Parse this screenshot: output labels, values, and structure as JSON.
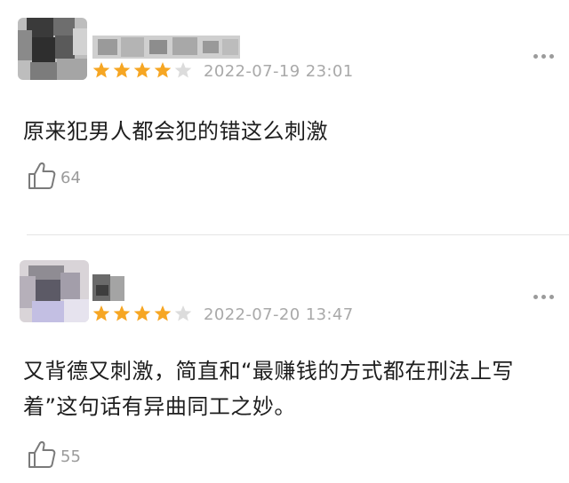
{
  "comments": [
    {
      "timestamp": "2022-07-19 23:01",
      "rating": 4,
      "text": "原来犯男人都会犯的错这么刺激",
      "likes": "64"
    },
    {
      "timestamp": "2022-07-20 13:47",
      "rating": 4,
      "text": "又背德又刺激，简直和“最赚钱的方式都在刑法上写着”这句话有异曲同工之妙。",
      "likes": "55"
    }
  ],
  "colors": {
    "star_filled": "#f6a623",
    "star_empty": "#dcdcdc",
    "text": "#1e1e1e",
    "meta": "#a9a9a9"
  },
  "icons": {
    "like": "thumbs-up-icon",
    "more": "more-dots-icon",
    "star": "star-icon"
  }
}
